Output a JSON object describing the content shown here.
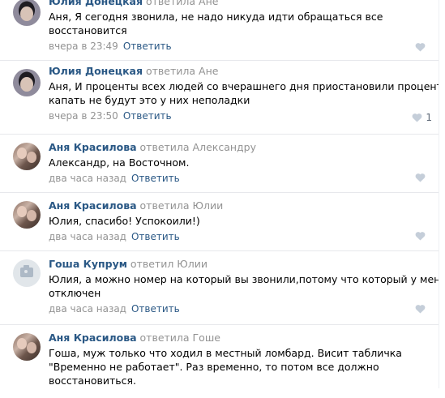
{
  "reply_label": "Ответить",
  "colors": {
    "link": "#2a5885",
    "muted": "#939393",
    "like_icon": "#c5ced9"
  },
  "comments": [
    {
      "author": "Юлия Донецкая",
      "replied": "ответила Ане",
      "avatar": "julia-avatar",
      "lines": [
        "Аня, Я сегодня звонила, не надо никуда идти обращаться все",
        "восстановится"
      ],
      "time": "вчера в 23:49",
      "likes": ""
    },
    {
      "author": "Юлия Донецкая",
      "replied": "ответила Ане",
      "avatar": "julia-avatar",
      "lines": [
        "Аня, И проценты всех людей со вчерашнего дня приостановили проценты",
        "капать не будут это у них неполадки"
      ],
      "time": "вчера в 23:50",
      "likes": "1"
    },
    {
      "author": "Аня Красилова",
      "replied": "ответила Александру",
      "avatar": "anya-avatar",
      "lines": [
        "Александр, на Восточном."
      ],
      "time": "два часа назад",
      "likes": ""
    },
    {
      "author": "Аня Красилова",
      "replied": "ответила Юлии",
      "avatar": "anya-avatar",
      "lines": [
        "Юлия, спасибо! Успокоили!)"
      ],
      "time": "два часа назад",
      "likes": ""
    },
    {
      "author": "Гоша Купрум",
      "replied": "ответил Юлии",
      "avatar": "camera-placeholder-avatar",
      "lines": [
        "Юлия, а можно номер на который вы звонили,потому что который у меня",
        "отключен"
      ],
      "time": "два часа назад",
      "likes": ""
    },
    {
      "author": "Аня Красилова",
      "replied": "ответила Гоше",
      "avatar": "anya-avatar",
      "lines": [
        "Гоша, муж только что ходил в местный ломбард. Висит табличка",
        "\"Временно не работает\". Раз временно, то потом все должно",
        "восстановиться."
      ],
      "time": "",
      "likes": ""
    }
  ]
}
